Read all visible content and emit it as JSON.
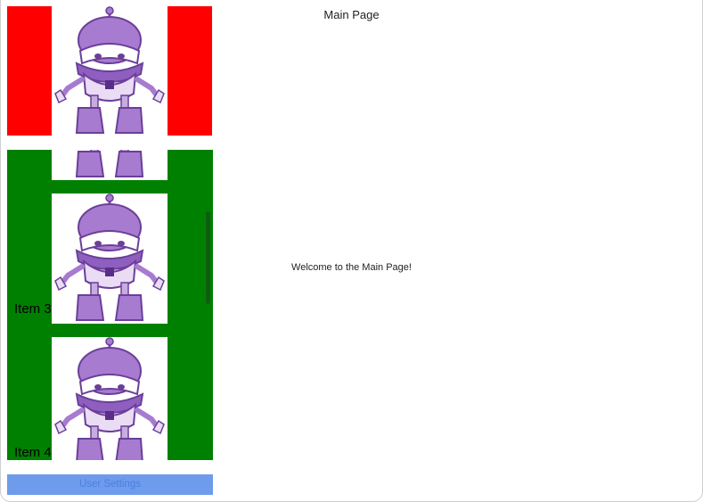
{
  "window": {
    "title": "Main Page"
  },
  "flyout": {
    "header_image": "dotnet-bot",
    "items": [
      {
        "label": "",
        "image": "dotnet-bot"
      },
      {
        "label": "Item 3",
        "image": "dotnet-bot"
      },
      {
        "label": "Item 4",
        "image": "dotnet-bot"
      }
    ],
    "footer_button": "User Settings"
  },
  "main": {
    "welcome_text": "Welcome to the Main Page!"
  },
  "colors": {
    "header_bg": "#ff0000",
    "list_bg": "#008000",
    "button_bg": "#6e9bec",
    "button_text": "#4b7fe2"
  }
}
